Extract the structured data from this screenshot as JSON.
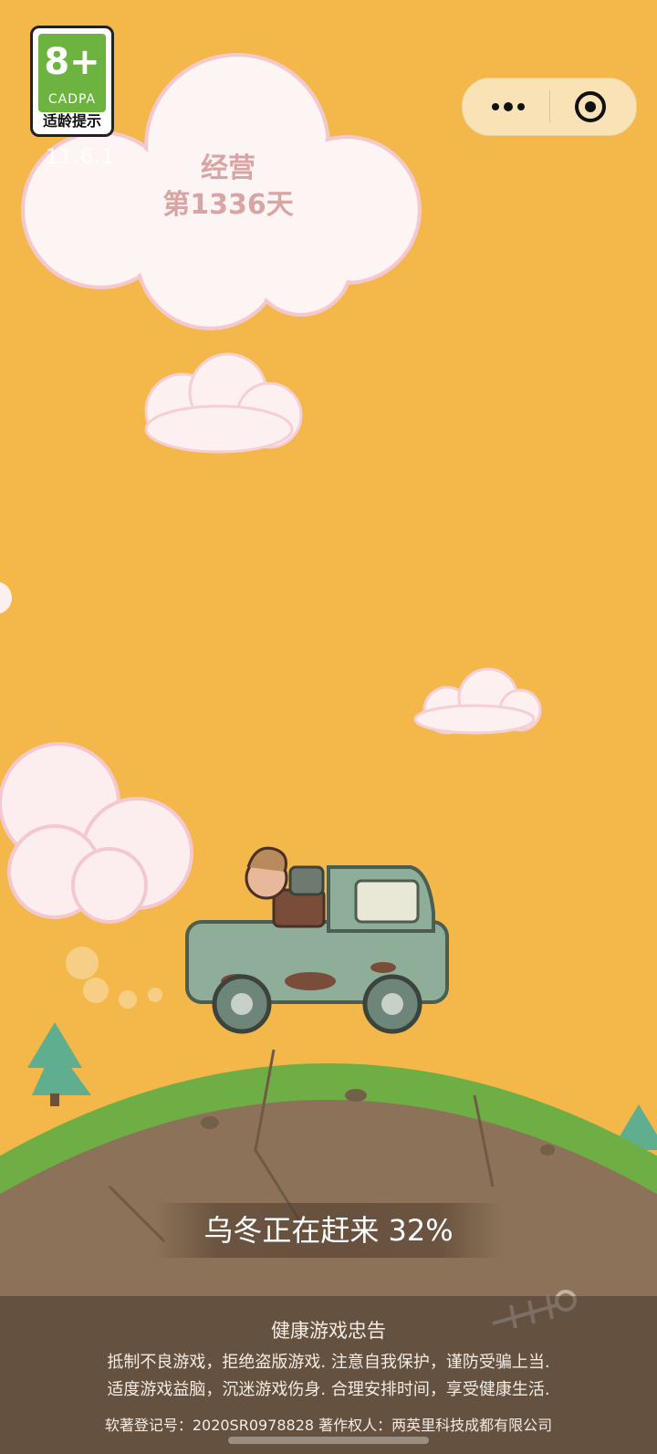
{
  "age_rating": {
    "value": "8+",
    "org": "CADPA",
    "caption": "适龄提示"
  },
  "version": "11.6.1",
  "day_counter": {
    "label": "经营",
    "value": "第1336天"
  },
  "loading": {
    "text": "乌冬正在赶来 32%",
    "progress_percent": 32
  },
  "health_notice": {
    "title": "健康游戏忠告",
    "line1": "抵制不良游戏，拒绝盗版游戏. 注意自我保护，谨防受骗上当.",
    "line2": "适度游戏益脑，沉迷游戏伤身. 合理安排时间，享受健康生活.",
    "copyright": "软著登记号：2020SR0978828   著作权人：两英里科技成都有限公司"
  },
  "capsule": {
    "more_icon": "more-dots-icon",
    "close_icon": "target-icon"
  },
  "colors": {
    "background": "#F4B74A",
    "badge_green": "#6DB33F",
    "grass": "#6FAE45",
    "dirt": "#8B7258"
  }
}
